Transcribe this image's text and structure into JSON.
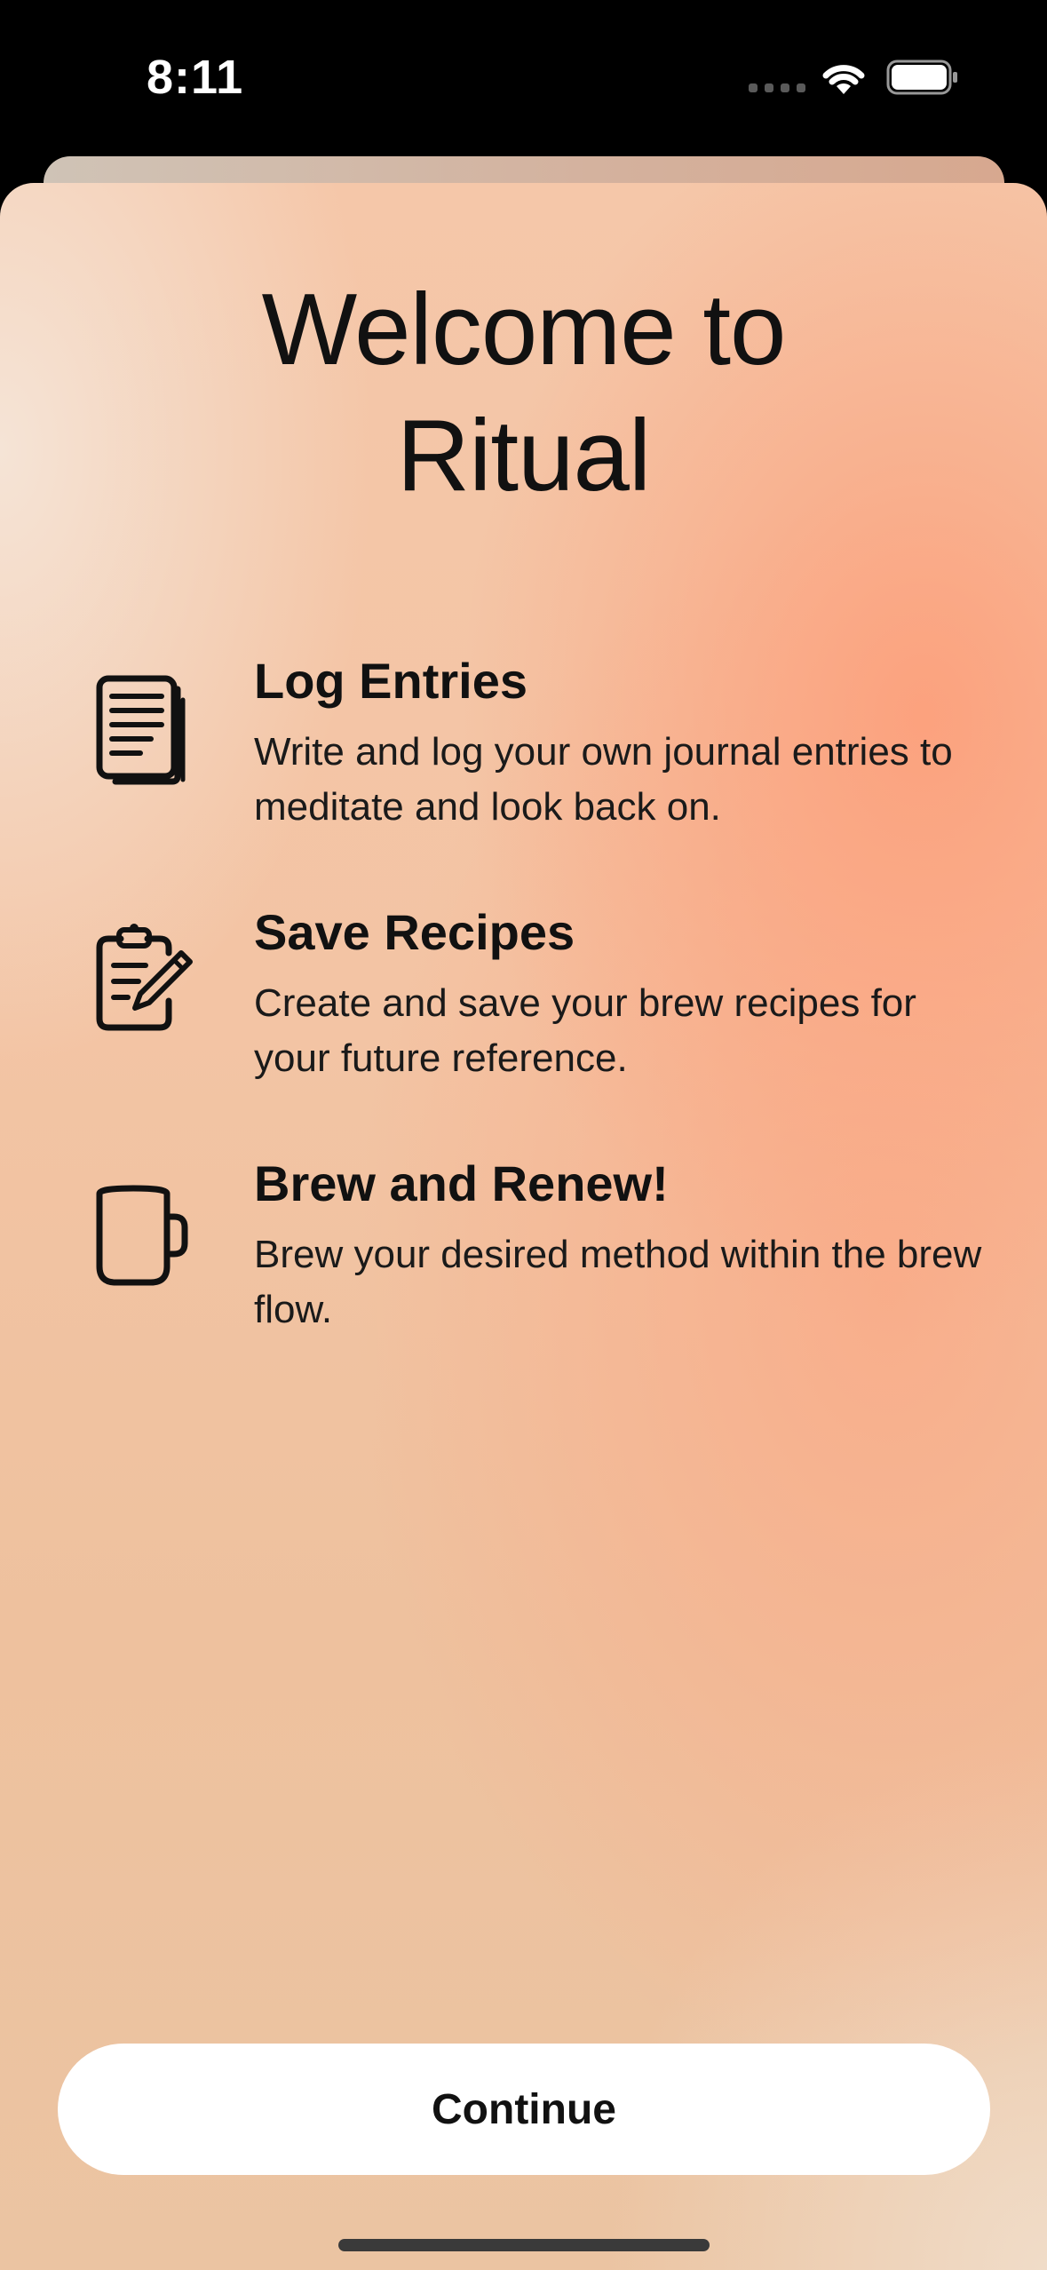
{
  "status_bar": {
    "time": "8:11",
    "icons": [
      "cellular-signal-icon",
      "wifi-icon",
      "battery-icon"
    ]
  },
  "onboarding": {
    "title_line1": "Welcome to",
    "title_line2": "Ritual",
    "features": [
      {
        "icon": "journal-pages-icon",
        "title": "Log Entries",
        "description": "Write and log your own journal entries to meditate and look back on."
      },
      {
        "icon": "clipboard-edit-icon",
        "title": "Save Recipes",
        "description": "Create and save your brew recipes for your future reference."
      },
      {
        "icon": "mug-icon",
        "title": "Brew and Renew!",
        "description": "Brew your desired method within the brew flow."
      }
    ],
    "continue_label": "Continue"
  },
  "colors": {
    "accent_peach": "#FCA07C",
    "background_cream": "#F5E4D6",
    "button_bg": "#FFFFFF",
    "text_primary": "#111111"
  }
}
